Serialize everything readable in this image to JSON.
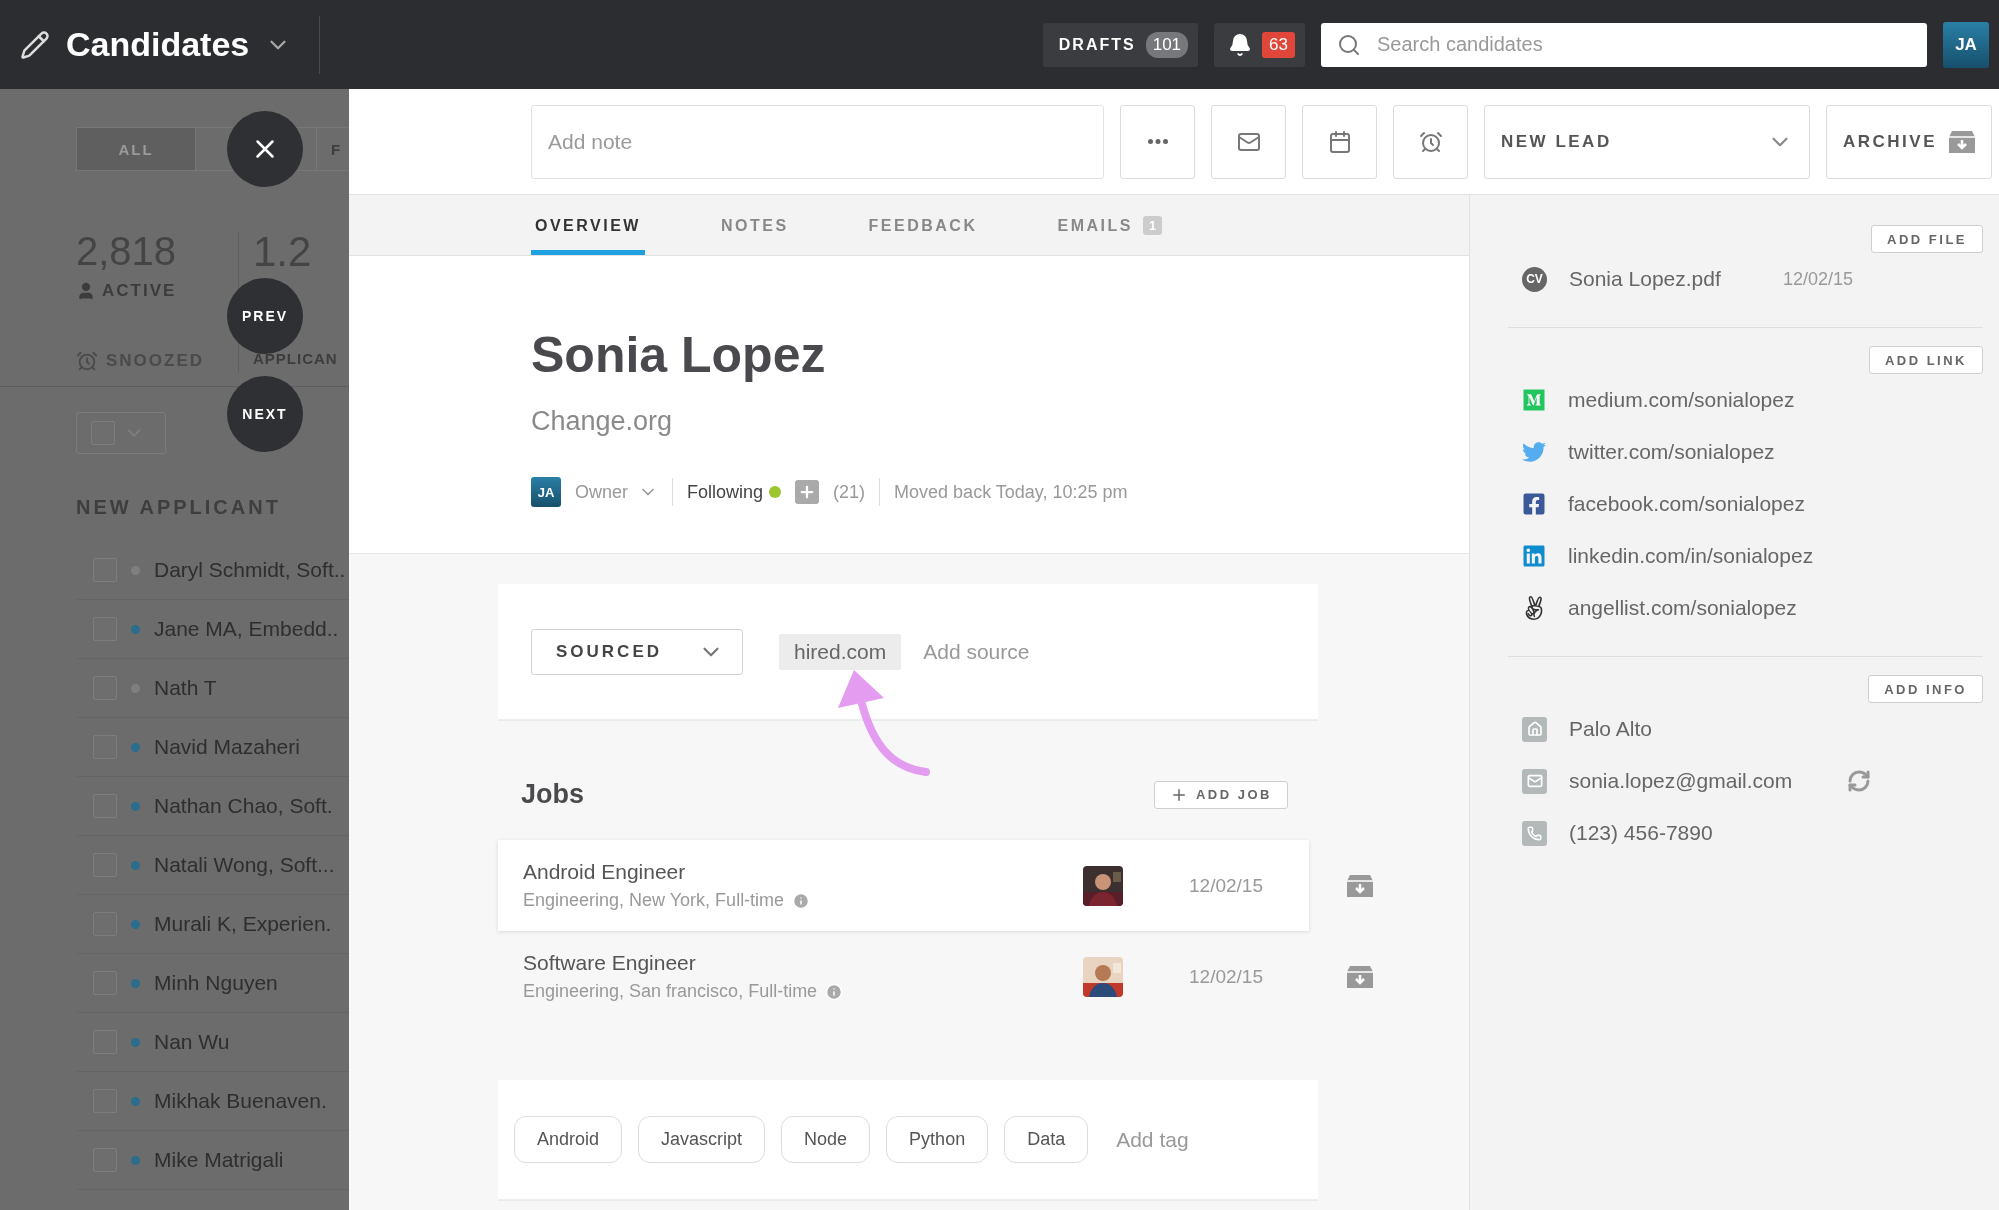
{
  "topbar": {
    "title": "Candidates",
    "drafts": {
      "label": "DRAFTS",
      "count": "101"
    },
    "notifications": "63",
    "search": {
      "placeholder": "Search candidates"
    },
    "user": "JA"
  },
  "left_panel": {
    "filters": [
      {
        "label": "ALL",
        "selected": true
      },
      {
        "label": "F",
        "selected": false
      }
    ],
    "stats": [
      {
        "value": "2,818",
        "label": "ACTIVE"
      },
      {
        "value": "1.2",
        "label": "APPLICAN"
      }
    ],
    "snoozed": "SNOOZED",
    "section": "NEW APPLICANT",
    "applicants": [
      {
        "name": "Daryl Schmidt, Soft..",
        "color": "#7f7f7f",
        "checked": false
      },
      {
        "name": "Jane MA, Embedd..",
        "color": "#2b6d8c",
        "checked": false
      },
      {
        "name": "Nath T",
        "color": "#7f7f7f",
        "checked": false
      },
      {
        "name": "Navid Mazaheri",
        "color": "#2b6d8c",
        "checked": false
      },
      {
        "name": "Nathan Chao, Soft.",
        "color": "#2b6d8c",
        "checked": false
      },
      {
        "name": "Natali Wong, Soft...",
        "color": "#2b6d8c",
        "checked": false
      },
      {
        "name": "Murali K, Experien.",
        "color": "#2b6d8c",
        "checked": false
      },
      {
        "name": "Minh Nguyen",
        "color": "#2b6d8c",
        "checked": false
      },
      {
        "name": "Nan Wu",
        "color": "#2b6d8c",
        "checked": false
      },
      {
        "name": "Mikhak Buenaven.",
        "color": "#2b6d8c",
        "checked": false
      },
      {
        "name": "Mike Matrigali",
        "color": "#2b6d8c",
        "checked": false
      }
    ],
    "nav": {
      "prev": "PREV",
      "next": "NEXT"
    }
  },
  "toolbar": {
    "note": {
      "placeholder": "Add note"
    },
    "stage": "NEW LEAD",
    "archive": "ARCHIVE"
  },
  "tabs": [
    {
      "label": "OVERVIEW",
      "selected": true
    },
    {
      "label": "NOTES",
      "selected": false
    },
    {
      "label": "FEEDBACK",
      "selected": false
    },
    {
      "label": "EMAILS",
      "selected": false,
      "badge": "1"
    }
  ],
  "profile": {
    "name": "Sonia Lopez",
    "company": "Change.org",
    "owner": {
      "initials": "JA",
      "label": "Owner"
    },
    "following": "Following",
    "followers": "(21)",
    "moved": "Moved back Today, 10:25 pm"
  },
  "source": {
    "stage": "SOURCED",
    "tag": "hired.com",
    "add": {
      "placeholder": "Add source"
    }
  },
  "jobs": {
    "title": "Jobs",
    "add": "ADD JOB",
    "items": [
      {
        "title": "Android Engineer",
        "details": "Engineering, New York, Full-time",
        "date": "12/02/15",
        "selected": true
      },
      {
        "title": "Software Engineer",
        "details": "Engineering, San francisco, Full-time",
        "date": "12/02/15",
        "selected": false
      }
    ]
  },
  "tags": {
    "items": [
      "Android",
      "Javascript",
      "Node",
      "Python",
      "Data"
    ],
    "add": {
      "placeholder": "Add tag"
    }
  },
  "sidebar": {
    "files": {
      "button": "ADD FILE",
      "items": [
        {
          "badge": "CV",
          "name": "Sonia Lopez.pdf",
          "date": "12/02/15"
        }
      ]
    },
    "links": {
      "button": "ADD LINK",
      "items": [
        {
          "kind": "medium",
          "text": "medium.com/sonialopez"
        },
        {
          "kind": "twitter",
          "text": "twitter.com/sonialopez"
        },
        {
          "kind": "facebook",
          "text": "facebook.com/sonialopez"
        },
        {
          "kind": "linkedin",
          "text": "linkedin.com/in/sonialopez"
        },
        {
          "kind": "angellist",
          "text": "angellist.com/sonialopez"
        }
      ]
    },
    "info": {
      "button": "ADD INFO",
      "items": [
        {
          "kind": "location",
          "text": "Palo Alto"
        },
        {
          "kind": "email",
          "text": "sonia.lopez@gmail.com"
        },
        {
          "kind": "phone",
          "text": "(123) 456-7890"
        }
      ]
    }
  }
}
